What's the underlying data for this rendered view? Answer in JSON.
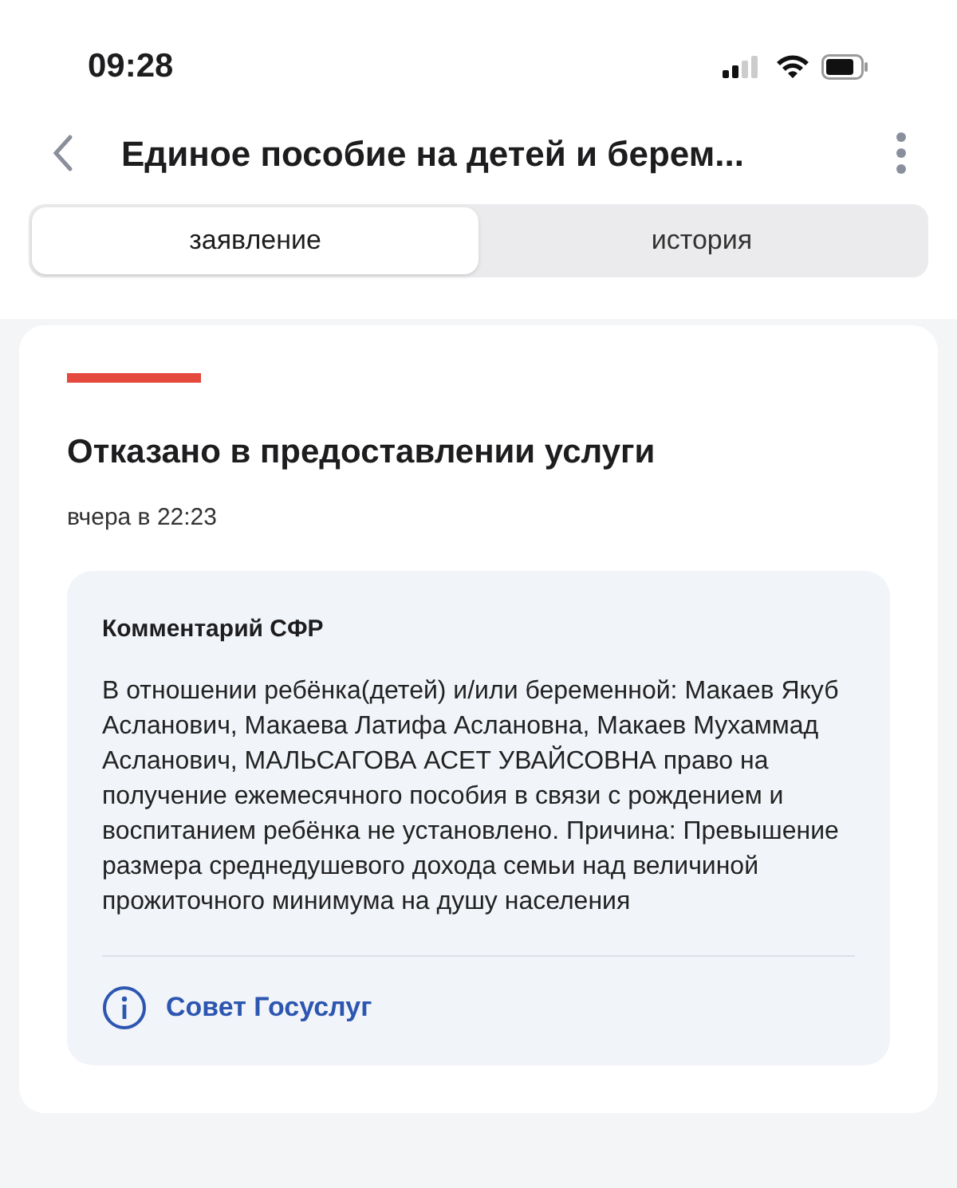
{
  "status_bar": {
    "time": "09:28"
  },
  "header": {
    "title": "Единое пособие на детей и берем..."
  },
  "tabs": [
    {
      "label": "заявление",
      "selected": true
    },
    {
      "label": "история",
      "selected": false
    }
  ],
  "card": {
    "status": "Отказано в предоставлении услуги",
    "date": "вчера в 22:23",
    "comment": {
      "title": "Комментарий СФР",
      "text": "В отношении ребёнка(детей) и/или беременной: Макаев Якуб Асланович, Макаева Латифа Аслановна, Макаев Мухаммад Асланович, МАЛЬСАГОВА АСЕТ УВАЙСОВНА право на получение ежемесячного пособия в связи с рождением и воспитанием ребёнка не установлено. Причина: Превышение размера среднедушевого дохода семьи над величиной прожиточного минимума на душу населения",
      "link": "Совет Госуслуг"
    }
  }
}
